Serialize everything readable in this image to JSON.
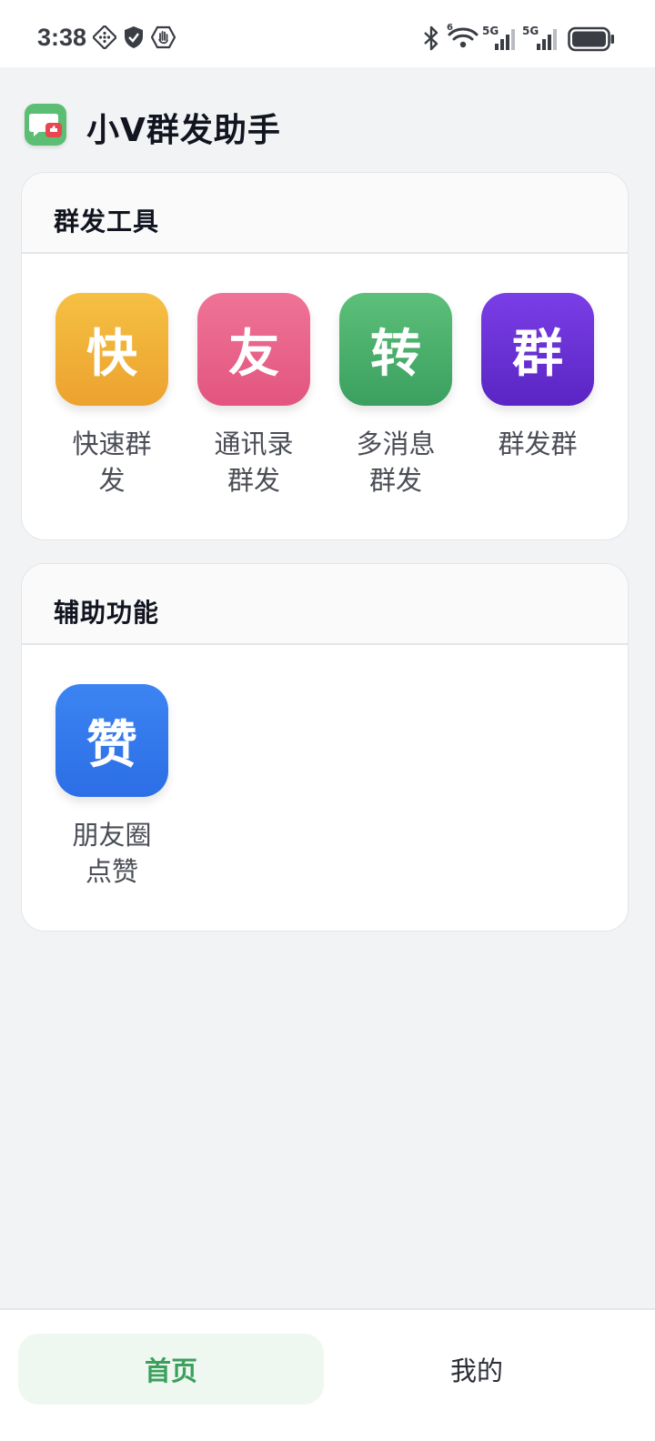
{
  "status_bar": {
    "time": "3:38",
    "left_icons": [
      "apps-grid-icon",
      "shield-check-icon",
      "hand-stop-icon"
    ],
    "right_icons": [
      "bluetooth-icon",
      "wifi-6-icon",
      "signal-5g-icon",
      "signal-5g-icon",
      "battery-icon"
    ],
    "wifi_badge": "6",
    "signal1_label": "5G",
    "signal2_label": "5G"
  },
  "app": {
    "title": "小V群发助手",
    "logo_icon": "chat-bubble-icon",
    "logo_color": "#5cbe73"
  },
  "sections": {
    "broadcast": {
      "title": "群发工具",
      "tools": [
        {
          "glyph": "快",
          "label": "快速群发",
          "color_top": "#f5c043",
          "color_bottom": "#eca22f"
        },
        {
          "glyph": "友",
          "label": "通讯录群发",
          "color_top": "#ef7396",
          "color_bottom": "#e2557f"
        },
        {
          "glyph": "转",
          "label": "多消息群发",
          "color_top": "#5cc07a",
          "color_bottom": "#3b9f5f"
        },
        {
          "glyph": "群",
          "label": "群发群",
          "color_top": "#7a3ee6",
          "color_bottom": "#5a25c3"
        }
      ]
    },
    "assist": {
      "title": "辅助功能",
      "tools": [
        {
          "glyph": "赞",
          "label": "朋友圈点赞",
          "color_top": "#3c84f2",
          "color_bottom": "#2c6ee6"
        }
      ]
    }
  },
  "tabbar": {
    "home_label": "首页",
    "mine_label": "我的",
    "active_tab": "首页",
    "accent": "#3c9f5c"
  }
}
